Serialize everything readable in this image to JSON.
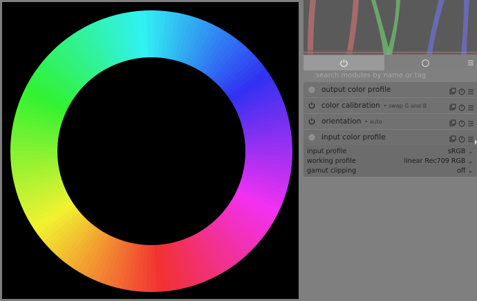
{
  "search": {
    "placeholder": "search modules by name or tag"
  },
  "modules": [
    {
      "name": "output color profile",
      "sub": "",
      "enabled": false
    },
    {
      "name": "color calibration",
      "sub": "• swap G and B",
      "enabled": true
    },
    {
      "name": "orientation",
      "sub": "• auto",
      "enabled": true
    },
    {
      "name": "input color profile",
      "sub": "",
      "enabled": false
    }
  ],
  "params": [
    {
      "label": "input profile",
      "value": "sRGB"
    },
    {
      "label": "working profile",
      "value": "linear Rec709 RGB"
    },
    {
      "label": "gamut clipping",
      "value": "off"
    }
  ],
  "icons": {
    "tab_active": "power-icon",
    "tab_circle": "circle-icon",
    "tab_menu": "hamburger-menu-icon",
    "search": "search-icon",
    "module_actions": [
      "multi-instance-icon",
      "reset-icon",
      "presets-icon"
    ]
  },
  "colors": {
    "panel_bg": "#7f7f7f",
    "module_bg": "#717171",
    "active_tab": "#9a9a9a",
    "histogram_bg": "#5a5a5a"
  }
}
